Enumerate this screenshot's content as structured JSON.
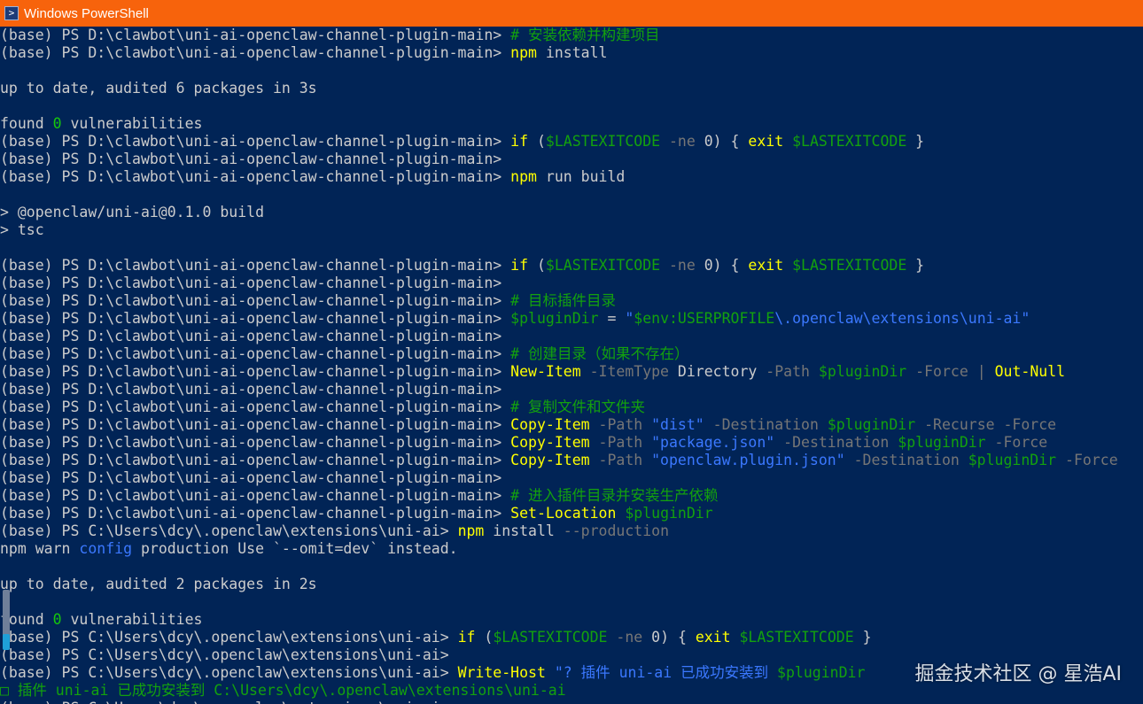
{
  "window": {
    "title": "Windows PowerShell",
    "icon": "powershell-icon"
  },
  "colors": {
    "background": "#012456",
    "titlebar": "#f7630c",
    "text": "#cccccc",
    "command": "#ffff00",
    "comment": "#13a10e",
    "parameter": "#767676",
    "string": "#3b78ff",
    "variable": "#13a10e",
    "number": "#16c60c"
  },
  "lines": [
    [
      {
        "t": "(base) PS D:\\clawbot\\uni-ai-openclaw-channel-plugin-main> ",
        "c": "text"
      },
      {
        "t": "# 安装依赖并构建项目",
        "c": "comment"
      }
    ],
    [
      {
        "t": "(base) PS D:\\clawbot\\uni-ai-openclaw-channel-plugin-main> ",
        "c": "text"
      },
      {
        "t": "npm",
        "c": "command"
      },
      {
        "t": " install",
        "c": "text"
      }
    ],
    [],
    [
      {
        "t": "up to date, audited 6 packages in 3s",
        "c": "text"
      }
    ],
    [],
    [
      {
        "t": "found ",
        "c": "text"
      },
      {
        "t": "0",
        "c": "number"
      },
      {
        "t": " vulnerabilities",
        "c": "text"
      }
    ],
    [
      {
        "t": "(base) PS D:\\clawbot\\uni-ai-openclaw-channel-plugin-main> ",
        "c": "text"
      },
      {
        "t": "if",
        "c": "command"
      },
      {
        "t": " (",
        "c": "text"
      },
      {
        "t": "$LASTEXITCODE",
        "c": "variable"
      },
      {
        "t": " -ne",
        "c": "parameter"
      },
      {
        "t": " 0) { ",
        "c": "text"
      },
      {
        "t": "exit",
        "c": "command"
      },
      {
        "t": " ",
        "c": "text"
      },
      {
        "t": "$LASTEXITCODE",
        "c": "variable"
      },
      {
        "t": " }",
        "c": "text"
      }
    ],
    [
      {
        "t": "(base) PS D:\\clawbot\\uni-ai-openclaw-channel-plugin-main>",
        "c": "text"
      }
    ],
    [
      {
        "t": "(base) PS D:\\clawbot\\uni-ai-openclaw-channel-plugin-main> ",
        "c": "text"
      },
      {
        "t": "npm",
        "c": "command"
      },
      {
        "t": " run build",
        "c": "text"
      }
    ],
    [],
    [
      {
        "t": "> @openclaw/uni-ai@0.1.0 build",
        "c": "text"
      }
    ],
    [
      {
        "t": "> tsc",
        "c": "text"
      }
    ],
    [],
    [
      {
        "t": "(base) PS D:\\clawbot\\uni-ai-openclaw-channel-plugin-main> ",
        "c": "text"
      },
      {
        "t": "if",
        "c": "command"
      },
      {
        "t": " (",
        "c": "text"
      },
      {
        "t": "$LASTEXITCODE",
        "c": "variable"
      },
      {
        "t": " -ne",
        "c": "parameter"
      },
      {
        "t": " 0) { ",
        "c": "text"
      },
      {
        "t": "exit",
        "c": "command"
      },
      {
        "t": " ",
        "c": "text"
      },
      {
        "t": "$LASTEXITCODE",
        "c": "variable"
      },
      {
        "t": " }",
        "c": "text"
      }
    ],
    [
      {
        "t": "(base) PS D:\\clawbot\\uni-ai-openclaw-channel-plugin-main>",
        "c": "text"
      }
    ],
    [
      {
        "t": "(base) PS D:\\clawbot\\uni-ai-openclaw-channel-plugin-main> ",
        "c": "text"
      },
      {
        "t": "# 目标插件目录",
        "c": "comment"
      }
    ],
    [
      {
        "t": "(base) PS D:\\clawbot\\uni-ai-openclaw-channel-plugin-main> ",
        "c": "text"
      },
      {
        "t": "$pluginDir",
        "c": "variable"
      },
      {
        "t": " = ",
        "c": "text"
      },
      {
        "t": "\"",
        "c": "string"
      },
      {
        "t": "$env:USERPROFILE",
        "c": "variable"
      },
      {
        "t": "\\.openclaw\\extensions\\uni-ai\"",
        "c": "string"
      }
    ],
    [
      {
        "t": "(base) PS D:\\clawbot\\uni-ai-openclaw-channel-plugin-main>",
        "c": "text"
      }
    ],
    [
      {
        "t": "(base) PS D:\\clawbot\\uni-ai-openclaw-channel-plugin-main> ",
        "c": "text"
      },
      {
        "t": "# 创建目录（如果不存在）",
        "c": "comment"
      }
    ],
    [
      {
        "t": "(base) PS D:\\clawbot\\uni-ai-openclaw-channel-plugin-main> ",
        "c": "text"
      },
      {
        "t": "New-Item",
        "c": "command"
      },
      {
        "t": " -ItemType",
        "c": "parameter"
      },
      {
        "t": " Directory",
        "c": "text"
      },
      {
        "t": " -Path",
        "c": "parameter"
      },
      {
        "t": " ",
        "c": "text"
      },
      {
        "t": "$pluginDir",
        "c": "variable"
      },
      {
        "t": " -Force",
        "c": "parameter"
      },
      {
        "t": " | ",
        "c": "parameter"
      },
      {
        "t": "Out-Null",
        "c": "command"
      }
    ],
    [
      {
        "t": "(base) PS D:\\clawbot\\uni-ai-openclaw-channel-plugin-main>",
        "c": "text"
      }
    ],
    [
      {
        "t": "(base) PS D:\\clawbot\\uni-ai-openclaw-channel-plugin-main> ",
        "c": "text"
      },
      {
        "t": "# 复制文件和文件夹",
        "c": "comment"
      }
    ],
    [
      {
        "t": "(base) PS D:\\clawbot\\uni-ai-openclaw-channel-plugin-main> ",
        "c": "text"
      },
      {
        "t": "Copy-Item",
        "c": "command"
      },
      {
        "t": " -Path",
        "c": "parameter"
      },
      {
        "t": " \"dist\"",
        "c": "string"
      },
      {
        "t": " -Destination",
        "c": "parameter"
      },
      {
        "t": " ",
        "c": "text"
      },
      {
        "t": "$pluginDir",
        "c": "variable"
      },
      {
        "t": " -Recurse -Force",
        "c": "parameter"
      }
    ],
    [
      {
        "t": "(base) PS D:\\clawbot\\uni-ai-openclaw-channel-plugin-main> ",
        "c": "text"
      },
      {
        "t": "Copy-Item",
        "c": "command"
      },
      {
        "t": " -Path",
        "c": "parameter"
      },
      {
        "t": " \"package.json\"",
        "c": "string"
      },
      {
        "t": " -Destination",
        "c": "parameter"
      },
      {
        "t": " ",
        "c": "text"
      },
      {
        "t": "$pluginDir",
        "c": "variable"
      },
      {
        "t": " -Force",
        "c": "parameter"
      }
    ],
    [
      {
        "t": "(base) PS D:\\clawbot\\uni-ai-openclaw-channel-plugin-main> ",
        "c": "text"
      },
      {
        "t": "Copy-Item",
        "c": "command"
      },
      {
        "t": " -Path",
        "c": "parameter"
      },
      {
        "t": " \"openclaw.plugin.json\"",
        "c": "string"
      },
      {
        "t": " -Destination",
        "c": "parameter"
      },
      {
        "t": " ",
        "c": "text"
      },
      {
        "t": "$pluginDir",
        "c": "variable"
      },
      {
        "t": " -Force",
        "c": "parameter"
      }
    ],
    [
      {
        "t": "(base) PS D:\\clawbot\\uni-ai-openclaw-channel-plugin-main>",
        "c": "text"
      }
    ],
    [
      {
        "t": "(base) PS D:\\clawbot\\uni-ai-openclaw-channel-plugin-main> ",
        "c": "text"
      },
      {
        "t": "# 进入插件目录并安装生产依赖",
        "c": "comment"
      }
    ],
    [
      {
        "t": "(base) PS D:\\clawbot\\uni-ai-openclaw-channel-plugin-main> ",
        "c": "text"
      },
      {
        "t": "Set-Location",
        "c": "command"
      },
      {
        "t": " ",
        "c": "text"
      },
      {
        "t": "$pluginDir",
        "c": "variable"
      }
    ],
    [
      {
        "t": "(base) PS C:\\Users\\dcy\\.openclaw\\extensions\\uni-ai> ",
        "c": "text"
      },
      {
        "t": "npm",
        "c": "command"
      },
      {
        "t": " install",
        "c": "text"
      },
      {
        "t": " --production",
        "c": "parameter"
      }
    ],
    [
      {
        "t": "npm warn ",
        "c": "text"
      },
      {
        "t": "config",
        "c": "string"
      },
      {
        "t": " production Use `--omit=dev` instead.",
        "c": "text"
      }
    ],
    [],
    [
      {
        "t": "up to date, audited 2 packages in 2s",
        "c": "text"
      }
    ],
    [],
    [
      {
        "t": "found ",
        "c": "text"
      },
      {
        "t": "0",
        "c": "number"
      },
      {
        "t": " vulnerabilities",
        "c": "text"
      }
    ],
    [
      {
        "t": "(base) PS C:\\Users\\dcy\\.openclaw\\extensions\\uni-ai> ",
        "c": "text"
      },
      {
        "t": "if",
        "c": "command"
      },
      {
        "t": " (",
        "c": "text"
      },
      {
        "t": "$LASTEXITCODE",
        "c": "variable"
      },
      {
        "t": " -ne",
        "c": "parameter"
      },
      {
        "t": " 0) { ",
        "c": "text"
      },
      {
        "t": "exit",
        "c": "command"
      },
      {
        "t": " ",
        "c": "text"
      },
      {
        "t": "$LASTEXITCODE",
        "c": "variable"
      },
      {
        "t": " }",
        "c": "text"
      }
    ],
    [
      {
        "t": "(base) PS C:\\Users\\dcy\\.openclaw\\extensions\\uni-ai>",
        "c": "text"
      }
    ],
    [
      {
        "t": "(base) PS C:\\Users\\dcy\\.openclaw\\extensions\\uni-ai> ",
        "c": "text"
      },
      {
        "t": "Write-Host",
        "c": "command"
      },
      {
        "t": " \"? 插件 uni-ai 已成功安装到 ",
        "c": "string"
      },
      {
        "t": "$pluginDir",
        "c": "variable"
      }
    ],
    [
      {
        "t": "□ 插件 uni-ai 已成功安装到 C:\\Users\\dcy\\.openclaw\\extensions\\uni-ai",
        "c": "comment"
      }
    ],
    [
      {
        "t": "(base) PS C:\\Users\\dcy\\.openclaw\\extensions\\uni-ai>",
        "c": "text"
      }
    ]
  ],
  "watermark": "掘金技术社区 @ 星浩AI"
}
